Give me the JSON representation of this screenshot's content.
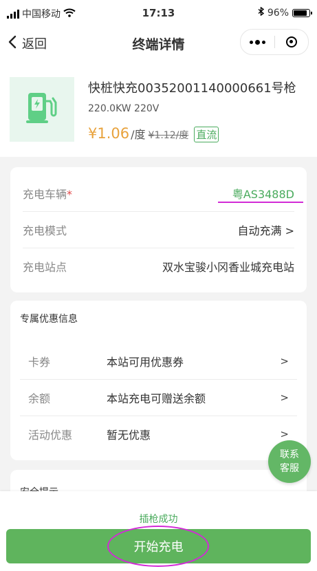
{
  "status_bar": {
    "carrier": "中国移动",
    "time": "17:13",
    "battery": "96%",
    "battery_level": 0.96
  },
  "nav": {
    "back_label": "返回",
    "title": "终端详情"
  },
  "product": {
    "icon": "charger-icon",
    "name": "快桩快充00352001140000661号枪",
    "spec": "220.0KW 220V",
    "price": "¥1.06",
    "unit": "/度",
    "old_price": "¥1.12/度",
    "tag": "直流"
  },
  "info": {
    "vehicle_label": "充电车辆",
    "required_mark": "*",
    "vehicle_value": "粤AS3488D",
    "mode_label": "充电模式",
    "mode_value": "自动充满 >",
    "station_label": "充电站点",
    "station_value": "双水宝骏小冈香业城充电站"
  },
  "discount": {
    "title": "专属优惠信息",
    "items": [
      {
        "label": "卡券",
        "value": "本站可用优惠券",
        "arrow": ">"
      },
      {
        "label": "余额",
        "value": "本站充电可赠送余额",
        "arrow": ">"
      },
      {
        "label": "活动优惠",
        "value": "暂无优惠",
        "arrow": ">"
      }
    ]
  },
  "next_section": {
    "title": "安全提示"
  },
  "service": {
    "line1": "联系",
    "line2": "客服"
  },
  "bottom": {
    "plug_status": "插枪成功",
    "start_label": "开始充电"
  },
  "colors": {
    "accent_green": "#5fb45d",
    "price_orange": "#e8a23c",
    "annotation_magenta": "#d22ad6"
  }
}
